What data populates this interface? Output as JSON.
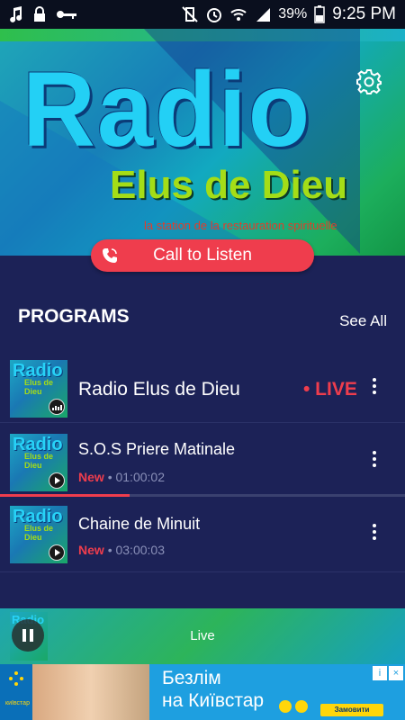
{
  "status_bar": {
    "battery": "39%",
    "time": "9:25 PM",
    "icons": [
      "music-icon",
      "lock-icon",
      "key-icon",
      "vibrate-off-icon",
      "alarm-icon",
      "wifi-icon",
      "signal-icon",
      "battery-icon"
    ]
  },
  "hero": {
    "logo_title": "Radio",
    "logo_subtitle": "Elus de Dieu",
    "tagline": "la station de la restauration spirituelle",
    "settings_icon": "gear-icon"
  },
  "call_button": {
    "label": "Call to Listen",
    "icon": "phone-icon"
  },
  "programs": {
    "heading": "PROGRAMS",
    "see_all": "See All",
    "items": [
      {
        "title": "Radio Elus de Dieu",
        "live": "• LIVE",
        "thumb_title": "Radio",
        "thumb_sub": "Elus de Dieu"
      },
      {
        "title": "S.O.S Priere Matinale",
        "badge": "New",
        "duration": "01:00:02",
        "thumb_title": "Radio",
        "thumb_sub": "Elus de Dieu"
      },
      {
        "title": "Chaine de Minuit",
        "badge": "New",
        "duration": "03:00:03",
        "thumb_title": "Radio",
        "thumb_sub": "Elus de Dieu"
      }
    ],
    "progress_fraction": 0.32
  },
  "player": {
    "label": "Live",
    "thumb_title": "Radio"
  },
  "ad": {
    "line1": "Безлім",
    "line2": "на Київстар",
    "cta": "Замовити",
    "brand": "київстар"
  },
  "colors": {
    "accent": "#ef3d4d",
    "background": "#1c2257"
  }
}
